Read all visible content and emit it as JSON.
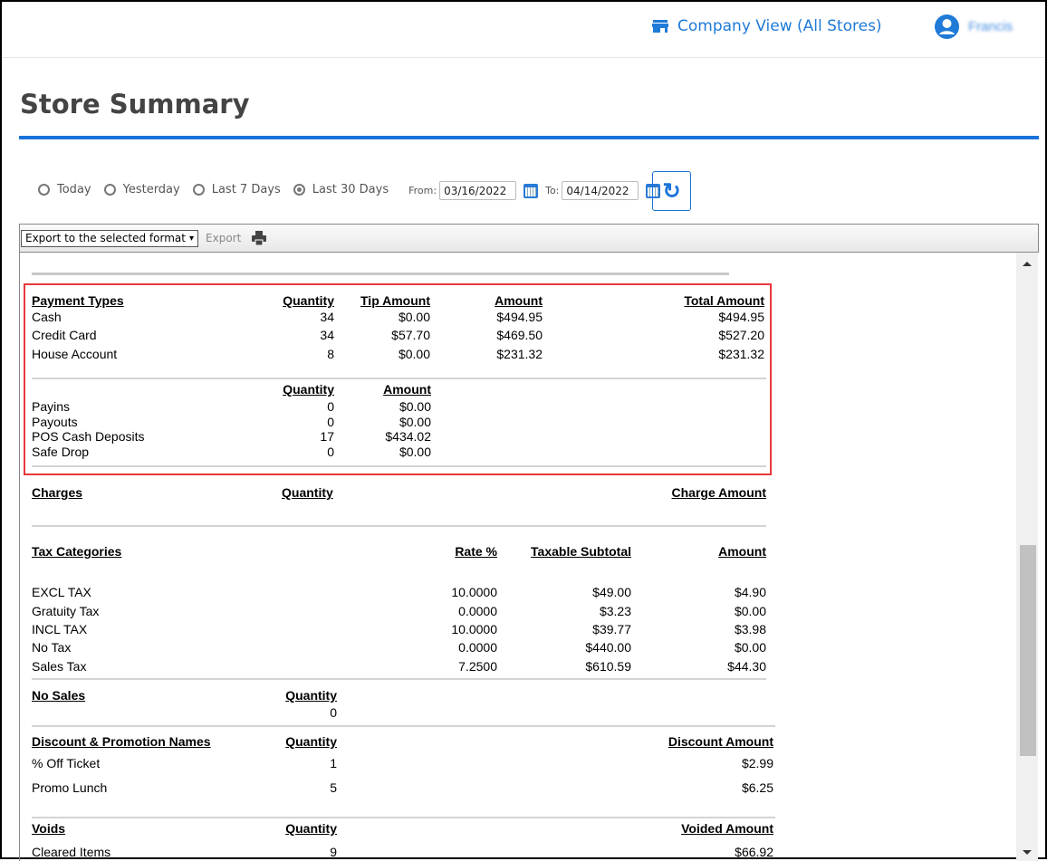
{
  "topnav": {
    "company": "Company View (All Stores)",
    "user": "Francis"
  },
  "page_title": "Store Summary",
  "filters": {
    "options": [
      {
        "label": "Today",
        "selected": false
      },
      {
        "label": "Yesterday",
        "selected": false
      },
      {
        "label": "Last 7 Days",
        "selected": false
      },
      {
        "label": "Last 30 Days",
        "selected": true
      }
    ],
    "from_label": "From:",
    "from": "03/16/2022",
    "to_label": "To:",
    "to": "04/14/2022"
  },
  "toolbar": {
    "export_select": "Export to the selected format",
    "export_button": "Export"
  },
  "sections": [
    {
      "id": "payment-types",
      "headers": [
        "Payment Types",
        "Quantity",
        "Tip Amount",
        "Amount",
        "Total Amount"
      ],
      "rows": [
        [
          "Cash",
          "34",
          "$0.00",
          "$494.95",
          "$494.95"
        ],
        [
          "Credit Card",
          "34",
          "$57.70",
          "$469.50",
          "$527.20"
        ],
        [
          "House Account",
          "8",
          "$0.00",
          "$231.32",
          "$231.32"
        ]
      ]
    },
    {
      "id": "cash-movements",
      "headers": [
        "",
        "Quantity",
        "Amount"
      ],
      "rows": [
        [
          "Payins",
          "0",
          "$0.00"
        ],
        [
          "Payouts",
          "0",
          "$0.00"
        ],
        [
          "POS Cash Deposits",
          "17",
          "$434.02"
        ],
        [
          "Safe Drop",
          "0",
          "$0.00"
        ]
      ]
    },
    {
      "id": "charges",
      "headers": [
        "Charges",
        "Quantity",
        "Charge Amount"
      ],
      "rows": []
    },
    {
      "id": "tax-categories",
      "headers": [
        "Tax Categories",
        "Rate %",
        "Taxable Subtotal",
        "Amount"
      ],
      "rows": [
        [
          "EXCL TAX",
          "10.0000",
          "$49.00",
          "$4.90"
        ],
        [
          "Gratuity Tax",
          "0.0000",
          "$3.23",
          "$0.00"
        ],
        [
          "INCL TAX",
          "10.0000",
          "$39.77",
          "$3.98"
        ],
        [
          "No Tax",
          "0.0000",
          "$440.00",
          "$0.00"
        ],
        [
          "Sales Tax",
          "7.2500",
          "$610.59",
          "$44.30"
        ]
      ]
    },
    {
      "id": "no-sales",
      "headers": [
        "No Sales",
        "Quantity"
      ],
      "rows": [
        [
          "",
          "0"
        ]
      ]
    },
    {
      "id": "discounts",
      "headers": [
        "Discount & Promotion Names",
        "Quantity",
        "Discount Amount"
      ],
      "rows": [
        [
          "% Off Ticket",
          "1",
          "$2.99"
        ],
        [
          "Promo Lunch",
          "5",
          "$6.25"
        ]
      ]
    },
    {
      "id": "voids",
      "headers": [
        "Voids",
        "Quantity",
        "Voided Amount"
      ],
      "rows": [
        [
          "Cleared Items",
          "9",
          "$66.92"
        ]
      ]
    }
  ]
}
